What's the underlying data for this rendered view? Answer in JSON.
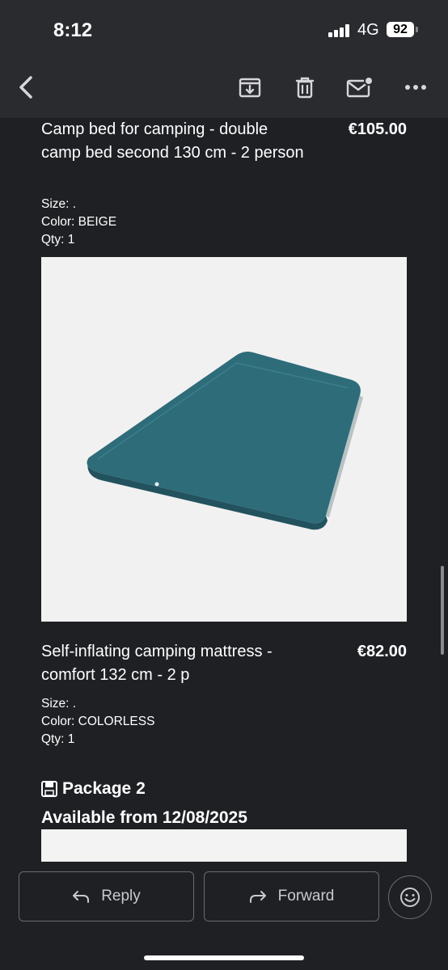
{
  "status_bar": {
    "time": "8:12",
    "network": "4G",
    "battery": "92"
  },
  "toolbar": {
    "icons": [
      "back-icon",
      "archive-icon",
      "delete-icon",
      "mark-unread-icon",
      "more-icon"
    ]
  },
  "items": [
    {
      "title": "Camp bed for camping - double camp bed second 130 cm - 2 person",
      "price": "€105.00",
      "size": "Size: .",
      "color": "Color: BEIGE",
      "qty": "Qty: 1"
    },
    {
      "title": "Self-inflating camping mattress - comfort 132 cm - 2 p",
      "price": "€82.00",
      "size": "Size: .",
      "color": "Color: COLORLESS",
      "qty": "Qty: 1"
    }
  ],
  "package": {
    "title": "Package 2",
    "date": "Available from 12/08/2025",
    "icon": "floppy-disk-icon"
  },
  "actions": {
    "reply": "Reply",
    "forward": "Forward"
  },
  "colors": {
    "background": "#1f2024",
    "bar": "#2a2b2f",
    "mattress": "#2f6f7d"
  }
}
